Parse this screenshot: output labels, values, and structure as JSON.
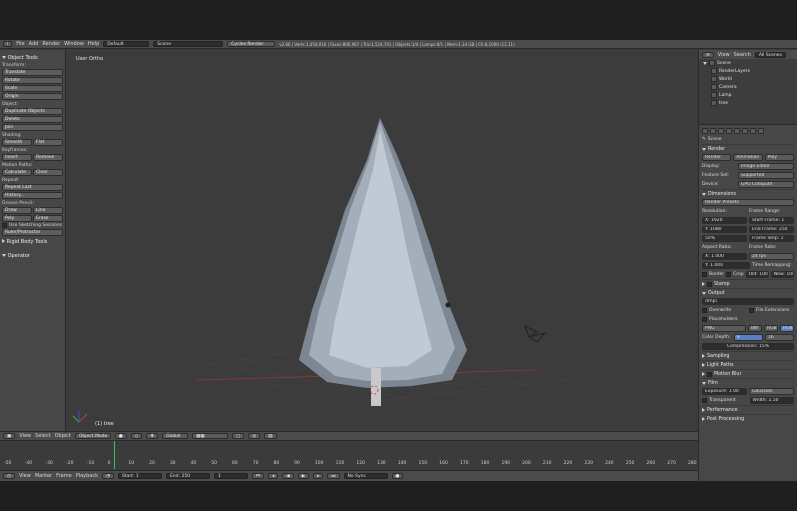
{
  "top_menu": {
    "editor_icon": "info-editor-icon",
    "items": [
      "File",
      "Add",
      "Render",
      "Window",
      "Help"
    ],
    "layout": "Default",
    "scene": "Scene",
    "engine": "Cycles Render",
    "stats": "v2.66 | Verts:1,454,016 | Faces:800,967 | Tris:1,524,741 | Objects:1/4 | Lamps:0/1 | Mem:1.34 GB | Ch:8,1000 (12.11)"
  },
  "tool_shelf": {
    "title": "Object Tools",
    "sections": {
      "transform_label": "Transform:",
      "transform": [
        "Translate",
        "Rotate",
        "Scale",
        "Origin"
      ],
      "object_label": "Object:",
      "object": [
        "Duplicate Objects",
        "Delete",
        "Join"
      ],
      "shading_label": "Shading:",
      "shading": [
        "Smooth",
        "Flat"
      ],
      "keyframes_label": "Keyframes:",
      "keyframes": [
        "Insert",
        "Remove"
      ],
      "motion_paths_label": "Motion Paths:",
      "motion_paths": [
        "Calculate",
        "Clear"
      ],
      "repeat_label": "Repeat:",
      "repeat": [
        "Repeat Last",
        "History..."
      ],
      "grease_pencil_label": "Grease Pencil:",
      "grease_pencil": [
        "Draw",
        "Line",
        "Poly",
        "Erase"
      ],
      "use_sketching": "Use Sketching Sessions",
      "ruler": "Ruler/Protractor",
      "rigid_body": "Rigid Body Tools",
      "operator": "Operator"
    }
  },
  "viewport": {
    "title": "User Ortho",
    "object_label": "(1) tree"
  },
  "header3d": {
    "items": [
      "View",
      "Select",
      "Object"
    ],
    "mode": "Object Mode",
    "orientation": "Global"
  },
  "timeline": {
    "ruler": [
      "-50",
      "-40",
      "-30",
      "-20",
      "-10",
      "0",
      "10",
      "20",
      "30",
      "40",
      "50",
      "60",
      "70",
      "80",
      "90",
      "100",
      "110",
      "120",
      "130",
      "140",
      "150",
      "160",
      "170",
      "180",
      "190",
      "200",
      "210",
      "220",
      "230",
      "240",
      "250",
      "260",
      "270",
      "280"
    ],
    "menus": [
      "View",
      "Marker",
      "Frame",
      "Playback"
    ],
    "start": "Start: 1",
    "end": "End: 250",
    "current": "1",
    "sync": "No Sync"
  },
  "outliner": {
    "menus": [
      "View",
      "Search"
    ],
    "filter": "All Scenes",
    "items": [
      "Scene",
      "RenderLayers",
      "World",
      "Camera",
      "Lamp",
      "tree"
    ]
  },
  "properties": {
    "context": "Scene",
    "render_panel": "Render",
    "render_btn": "Render",
    "animation_btn": "Animation",
    "play_btn": "Play",
    "display_label": "Display:",
    "display_value": "Image Editor",
    "feature_set_label": "Feature Set:",
    "feature_set_value": "Supported",
    "device_label": "Device:",
    "device_value": "GPU Compute",
    "dimensions_panel": "Dimensions",
    "render_presets": "Render Presets",
    "resolution_label": "Resolution:",
    "frame_range_label": "Frame Range:",
    "res_x": "X: 1920",
    "res_y": "Y: 1080",
    "res_pct": "50%",
    "start_frame": "Start Frame: 1",
    "end_frame": "End Frame: 250",
    "frame_step": "Frame Step: 1",
    "aspect_label": "Aspect Ratio:",
    "frame_rate_label": "Frame Rate:",
    "aspect_x": "X: 1.000",
    "aspect_y": "Y: 1.000",
    "fps": "24 fps",
    "time_remap": "Time Remapping:",
    "border": "Border",
    "crop": "Crop",
    "old": "Old: 100",
    "new": "New: 100",
    "stamp_panel": "Stamp",
    "output_panel": "Output",
    "output_path": "/tmp\\",
    "overwrite": "Overwrite",
    "file_ext": "File Extensions",
    "placeholders": "Placeholders",
    "format": "PNG",
    "bw": "BW",
    "rgb": "RGB",
    "rgba": "RGBA",
    "color_depth_label": "Color Depth:",
    "color_depth_8": "8",
    "color_depth_16": "16",
    "compression": "Compression: 15%",
    "sampling_panel": "Sampling",
    "light_paths_panel": "Light Paths",
    "motion_blur_panel": "Motion Blur",
    "film_panel": "Film",
    "exposure": "Exposure: 1.00",
    "filter": "Gaussian",
    "transparent": "Transparent",
    "width": "Width: 1.50",
    "performance_panel": "Performance",
    "post_processing_panel": "Post Processing"
  },
  "colors": {
    "tree": "#bcc6d2",
    "accent_blue": "#5680c2",
    "frame_marker": "#3fbf4f"
  }
}
